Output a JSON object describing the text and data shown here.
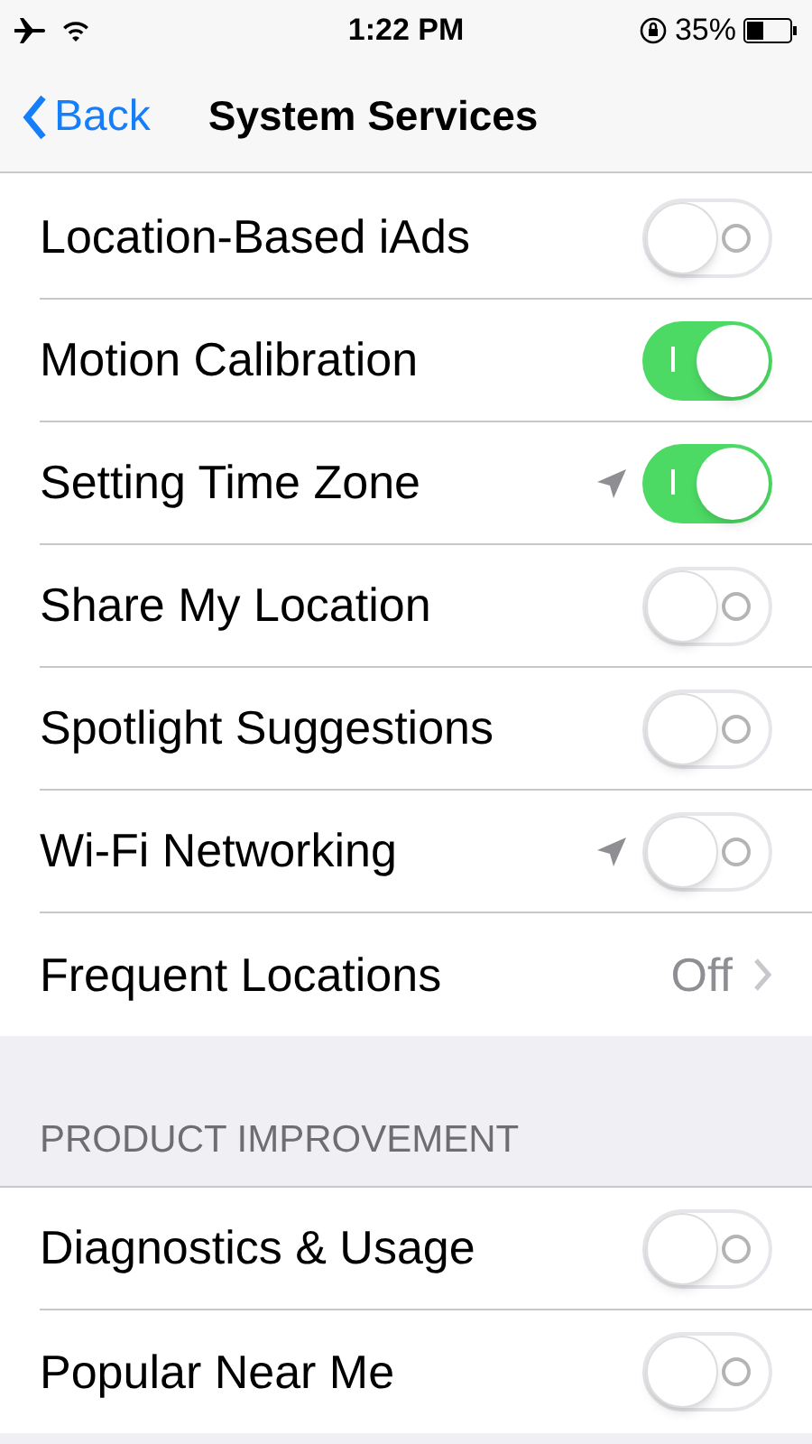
{
  "status_bar": {
    "time": "1:22 PM",
    "battery": "35%"
  },
  "nav": {
    "back": "Back",
    "title": "System Services"
  },
  "sections": [
    {
      "rows": [
        {
          "kind": "toggle",
          "label": "Location-Based iAds",
          "on": false,
          "location_used": false
        },
        {
          "kind": "toggle",
          "label": "Motion Calibration",
          "on": true,
          "location_used": false
        },
        {
          "kind": "toggle",
          "label": "Setting Time Zone",
          "on": true,
          "location_used": true
        },
        {
          "kind": "toggle",
          "label": "Share My Location",
          "on": false,
          "location_used": false
        },
        {
          "kind": "toggle",
          "label": "Spotlight Suggestions",
          "on": false,
          "location_used": false
        },
        {
          "kind": "toggle",
          "label": "Wi-Fi Networking",
          "on": false,
          "location_used": true
        },
        {
          "kind": "link",
          "label": "Frequent Locations",
          "value": "Off"
        }
      ]
    },
    {
      "header": "PRODUCT IMPROVEMENT",
      "rows": [
        {
          "kind": "toggle",
          "label": "Diagnostics & Usage",
          "on": false,
          "location_used": false
        },
        {
          "kind": "toggle",
          "label": "Popular Near Me",
          "on": false,
          "location_used": false
        }
      ]
    }
  ]
}
